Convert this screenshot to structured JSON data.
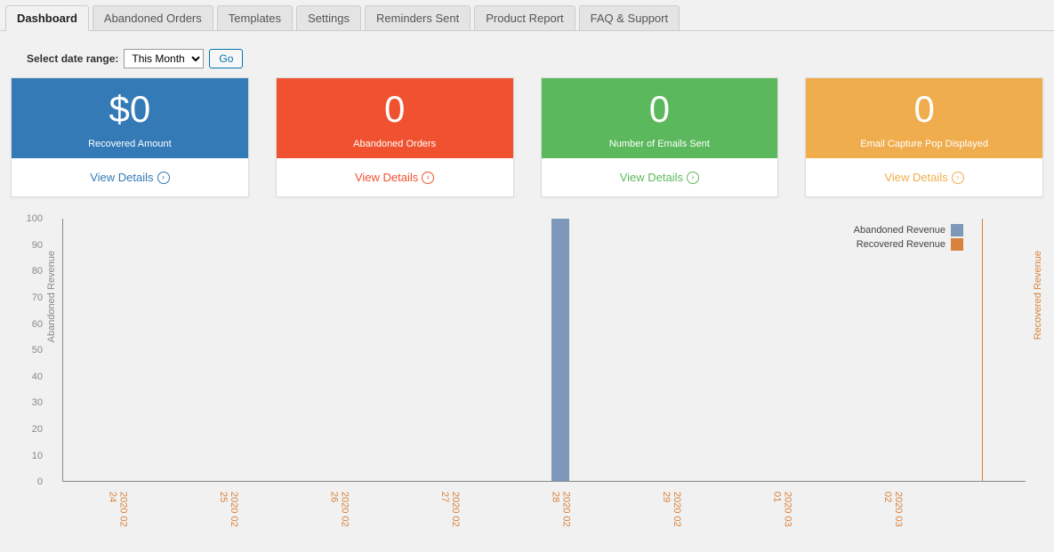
{
  "tabs": [
    {
      "label": "Dashboard",
      "active": true
    },
    {
      "label": "Abandoned Orders"
    },
    {
      "label": "Templates"
    },
    {
      "label": "Settings"
    },
    {
      "label": "Reminders Sent"
    },
    {
      "label": "Product Report"
    },
    {
      "label": "FAQ & Support"
    }
  ],
  "daterange": {
    "label": "Select date range:",
    "selected": "This Month",
    "go_label": "Go"
  },
  "cards": [
    {
      "value": "$0",
      "label": "Recovered Amount",
      "link": "View Details",
      "color": "blue"
    },
    {
      "value": "0",
      "label": "Abandoned Orders",
      "link": "View Details",
      "color": "orange"
    },
    {
      "value": "0",
      "label": "Number of Emails Sent",
      "link": "View Details",
      "color": "green"
    },
    {
      "value": "0",
      "label": "Email Capture Pop Displayed",
      "link": "View Details",
      "color": "yellow"
    }
  ],
  "chart_data": {
    "type": "bar",
    "categories": [
      "2020 02 24",
      "2020 02 25",
      "2020 02 26",
      "2020 02 27",
      "2020 02 28",
      "2020 02 29",
      "2020 03 01",
      "2020 03 02"
    ],
    "series": [
      {
        "name": "Abandoned Revenue",
        "color": "#7e98b9",
        "values": [
          0,
          0,
          0,
          0,
          100,
          0,
          0,
          0
        ]
      },
      {
        "name": "Recovered Revenue",
        "color": "#d9823b",
        "values": [
          0,
          0,
          0,
          0,
          0,
          0,
          0,
          0
        ]
      }
    ],
    "ylabel_left": "Abandoned Revenue",
    "ylabel_right": "Recovered Revenue",
    "ylim": [
      0,
      100
    ],
    "y_ticks": [
      0,
      10,
      20,
      30,
      40,
      50,
      60,
      70,
      80,
      90,
      100
    ]
  }
}
